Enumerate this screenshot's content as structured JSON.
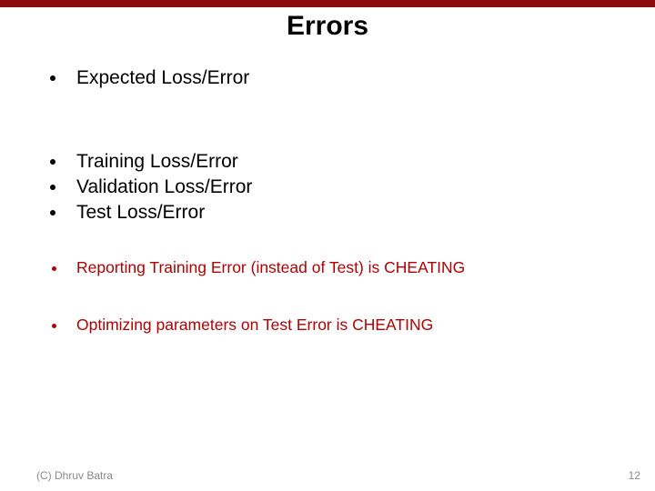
{
  "title": "Errors",
  "bullets_black_1": [
    "Expected Loss/Error"
  ],
  "bullets_black_2": [
    "Training Loss/Error",
    "Validation Loss/Error",
    "Test Loss/Error"
  ],
  "bullets_red": [
    "Reporting Training Error (instead of Test) is CHEATING",
    "Optimizing parameters on Test Error is CHEATING"
  ],
  "footer": {
    "copyright": "(C) Dhruv Batra",
    "page": "12"
  }
}
